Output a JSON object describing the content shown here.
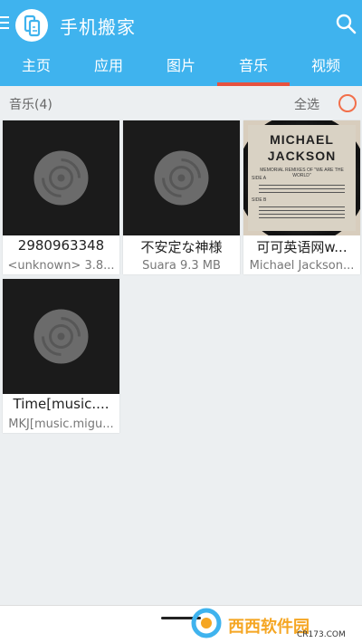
{
  "app": {
    "title": "手机搬家"
  },
  "tabs": [
    {
      "label": "主页"
    },
    {
      "label": "应用"
    },
    {
      "label": "图片"
    },
    {
      "label": "音乐"
    },
    {
      "label": "视频"
    }
  ],
  "active_tab": "音乐",
  "list": {
    "title": "音乐(4)",
    "select_all": "全选"
  },
  "songs": [
    {
      "title": "2980963348",
      "subtitle": "<unknown> 3.8...",
      "art": "vinyl-placeholder"
    },
    {
      "title": "不安定な神様",
      "subtitle": "Suara 9.3 MB",
      "art": "vinyl-placeholder"
    },
    {
      "title": "可可英语网w...",
      "subtitle": "Michael Jackson...",
      "art": "album-cover"
    },
    {
      "title": "Time[music....",
      "subtitle": "MKJ[music.migu...",
      "art": "vinyl-placeholder"
    }
  ],
  "album_cover": {
    "line1": "MICHAEL",
    "line2": "JACKSON",
    "caption": "MEMORIAL REMIXES OF \"WE ARE THE WORLD\"",
    "side": "SIDE A",
    "side_b": "SIDE B"
  },
  "watermark": {
    "text": "西西软件园",
    "sub": "CR173.COM"
  },
  "colors": {
    "primary": "#3fb3ee",
    "accent": "#e7523f",
    "select": "#f26f4a"
  }
}
